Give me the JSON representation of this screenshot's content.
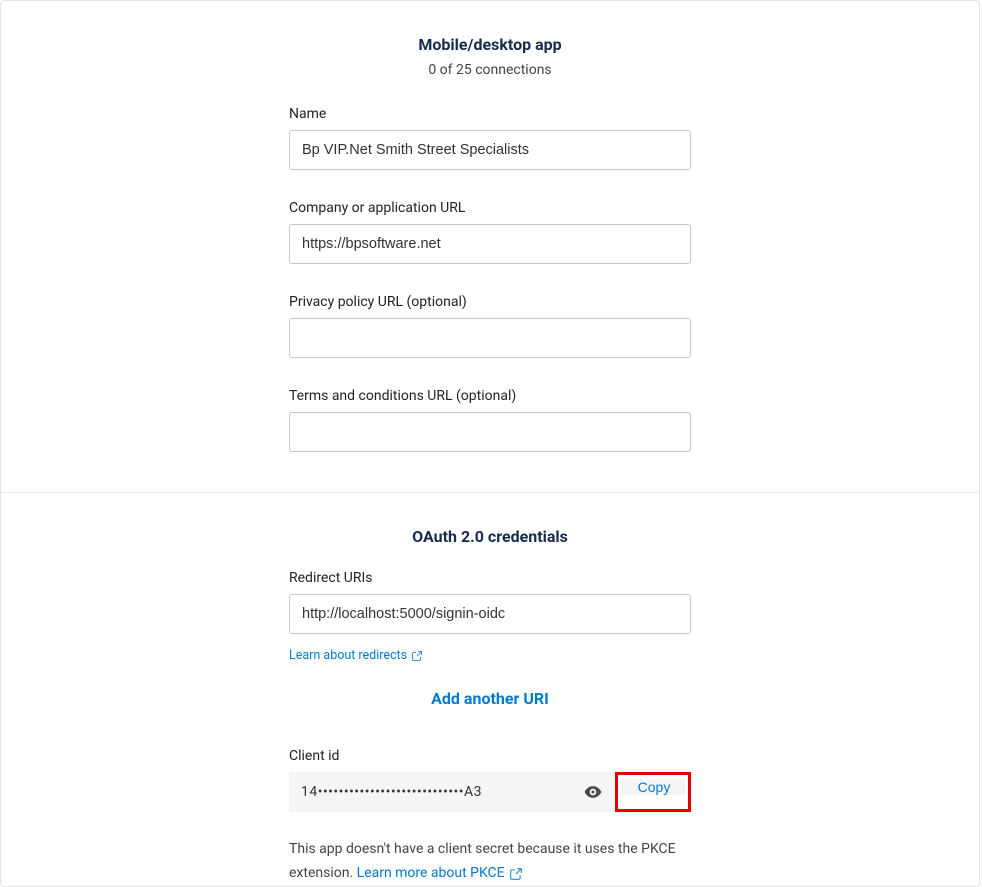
{
  "app": {
    "section1": {
      "title": "Mobile/desktop app",
      "connections": "0 of 25 connections",
      "fields": {
        "name": {
          "label": "Name",
          "value": "Bp VIP.Net Smith Street Specialists"
        },
        "companyUrl": {
          "label": "Company or application URL",
          "value": "https://bpsoftware.net"
        },
        "privacyUrl": {
          "label": "Privacy policy URL (optional)",
          "value": ""
        },
        "termsUrl": {
          "label": "Terms and conditions URL (optional)",
          "value": ""
        }
      }
    },
    "section2": {
      "title": "OAuth 2.0 credentials",
      "redirect": {
        "label": "Redirect URIs",
        "value": "http://localhost:5000/signin-oidc",
        "learnLink": "Learn about redirects"
      },
      "addUri": "Add another URI",
      "clientId": {
        "label": "Client id",
        "maskedValue": "14••••••••••••••••••••••••••••A3",
        "copyLabel": "Copy"
      },
      "note": {
        "textBefore": "This app doesn't have a client secret because it uses the PKCE extension. ",
        "linkText": "Learn more about PKCE"
      }
    }
  }
}
